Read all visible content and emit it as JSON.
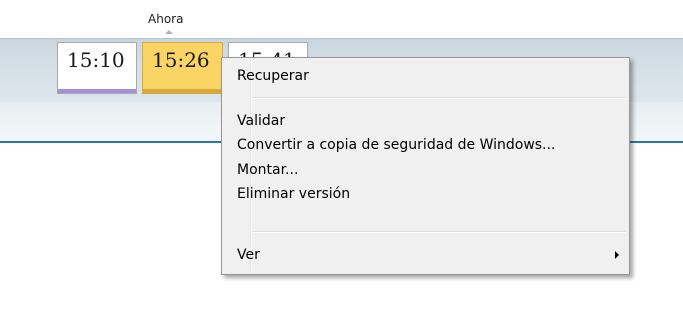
{
  "timeline": {
    "now_label": "Ahora",
    "versions": [
      {
        "time": "15:10",
        "bar_color": "#a68fd6"
      },
      {
        "time": "15:26",
        "bar_color": "#d9a93a",
        "selected": true
      },
      {
        "time": "15:41",
        "bar_color": "#a68fd6"
      }
    ]
  },
  "context_menu": {
    "items": [
      {
        "label": "Recuperar"
      },
      {
        "label": "Validar"
      },
      {
        "label": "Convertir a copia de seguridad de Windows..."
      },
      {
        "label": "Montar..."
      },
      {
        "label": "Eliminar versión"
      },
      {
        "label": "Ver",
        "submenu_icon": "chevron-right-icon"
      }
    ]
  }
}
